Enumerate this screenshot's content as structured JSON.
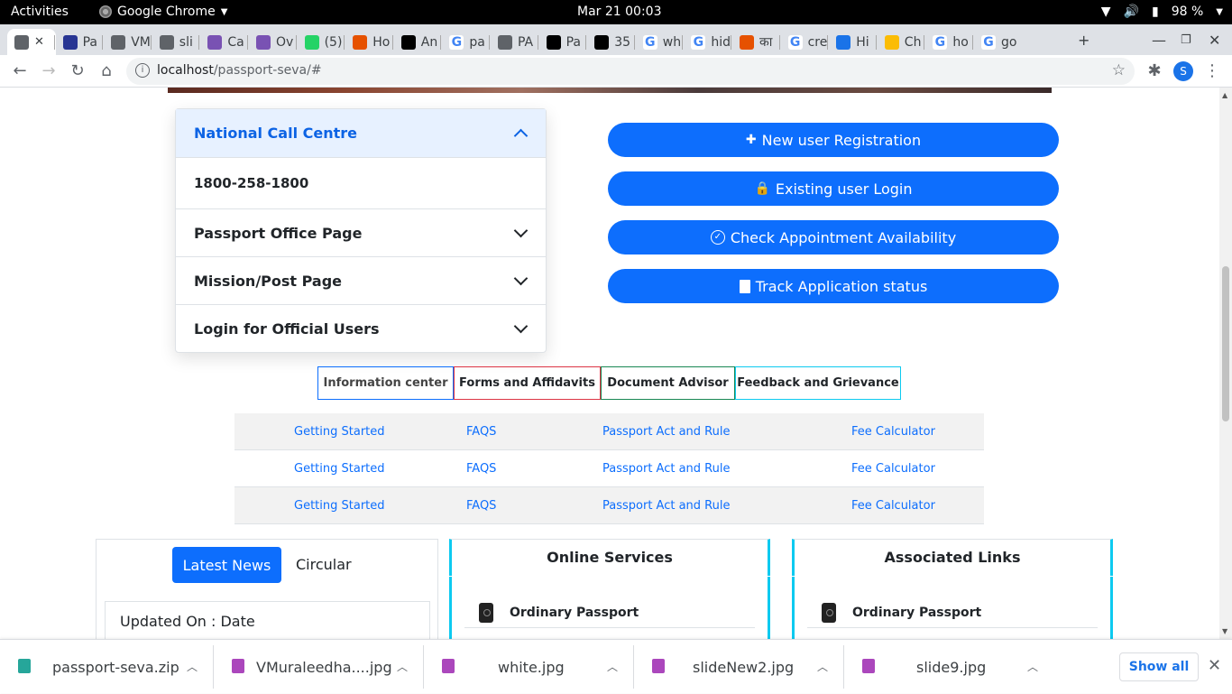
{
  "os": {
    "activities": "Activities",
    "app_name": "Google Chrome",
    "clock": "Mar 21  00:03",
    "battery": "98 %"
  },
  "tabs": [
    {
      "label": "",
      "favicon_color": "#5f6368",
      "active": true
    },
    {
      "label": "Pa",
      "favicon_color": "#283593"
    },
    {
      "label": "VM",
      "favicon_color": "#5f6368"
    },
    {
      "label": "sli",
      "favicon_color": "#5f6368"
    },
    {
      "label": "Ca",
      "favicon_color": "#7952b3"
    },
    {
      "label": "Ov",
      "favicon_color": "#7952b3"
    },
    {
      "label": "(5)",
      "favicon_color": "#25d366"
    },
    {
      "label": "Ho",
      "favicon_color": "#e65100"
    },
    {
      "label": "An",
      "favicon_color": "#000000"
    },
    {
      "label": "pa",
      "favicon_color": "#4285f4"
    },
    {
      "label": "PA",
      "favicon_color": "#5f6368"
    },
    {
      "label": "Pa",
      "favicon_color": "#000000"
    },
    {
      "label": "35",
      "favicon_color": "#000000"
    },
    {
      "label": "wh",
      "favicon_color": "#4285f4"
    },
    {
      "label": "hid",
      "favicon_color": "#4285f4"
    },
    {
      "label": "का",
      "favicon_color": "#e65100"
    },
    {
      "label": "cre",
      "favicon_color": "#4285f4"
    },
    {
      "label": "Hi",
      "favicon_color": "#1a73e8"
    },
    {
      "label": "Ch",
      "favicon_color": "#fbbc04"
    },
    {
      "label": "ho",
      "favicon_color": "#4285f4"
    },
    {
      "label": "go",
      "favicon_color": "#4285f4"
    }
  ],
  "toolbar": {
    "url_host": "localhost",
    "url_path": "/passport-seva/#",
    "profile_initial": "S"
  },
  "accordion": {
    "items": [
      {
        "title": "National Call Centre",
        "open": true,
        "body": "1800-258-1800"
      },
      {
        "title": "Passport Office Page",
        "open": false
      },
      {
        "title": "Mission/Post Page",
        "open": false
      },
      {
        "title": "Login for Official Users",
        "open": false
      }
    ]
  },
  "actions": [
    {
      "icon": "user-plus-icon",
      "glyph": "👤+",
      "label": "New user Registration"
    },
    {
      "icon": "user-lock-icon",
      "glyph": "👤🔒",
      "label": "Existing user Login"
    },
    {
      "icon": "check-circle-icon",
      "glyph": "✓",
      "label": "Check Appointment Availability"
    },
    {
      "icon": "book-icon",
      "glyph": "▮",
      "label": "Track Application status"
    }
  ],
  "info_tabs": [
    {
      "label": "Information center",
      "border": "#0d6efd"
    },
    {
      "label": "Forms and Affidavits",
      "border": "#dc3545"
    },
    {
      "label": "Document Advisor",
      "border": "#198754"
    },
    {
      "label": "Feedback and Grievance",
      "border": "#0dcaf0"
    }
  ],
  "link_rows": [
    [
      "Getting Started",
      "FAQS",
      "Passport Act and Rule",
      "Fee Calculator"
    ],
    [
      "Getting Started",
      "FAQS",
      "Passport Act and Rule",
      "Fee Calculator"
    ],
    [
      "Getting Started",
      "FAQS",
      "Passport Act and Rule",
      "Fee Calculator"
    ]
  ],
  "news": {
    "latest_label": "Latest News",
    "circular_label": "Circular",
    "updated": "Updated On : Date"
  },
  "online_services": {
    "title": "Online Services",
    "first_item": "Ordinary Passport"
  },
  "associated_links": {
    "title": "Associated Links",
    "first_item": "Ordinary Passport"
  },
  "downloads": {
    "items": [
      {
        "name": "passport-seva.zip",
        "color": "#26a69a"
      },
      {
        "name": "VMuraleedha....jpg",
        "color": "#ab47bc"
      },
      {
        "name": "white.jpg",
        "color": "#ab47bc"
      },
      {
        "name": "slideNew2.jpg",
        "color": "#ab47bc"
      },
      {
        "name": "slide9.jpg",
        "color": "#ab47bc"
      }
    ],
    "show_all": "Show all"
  }
}
